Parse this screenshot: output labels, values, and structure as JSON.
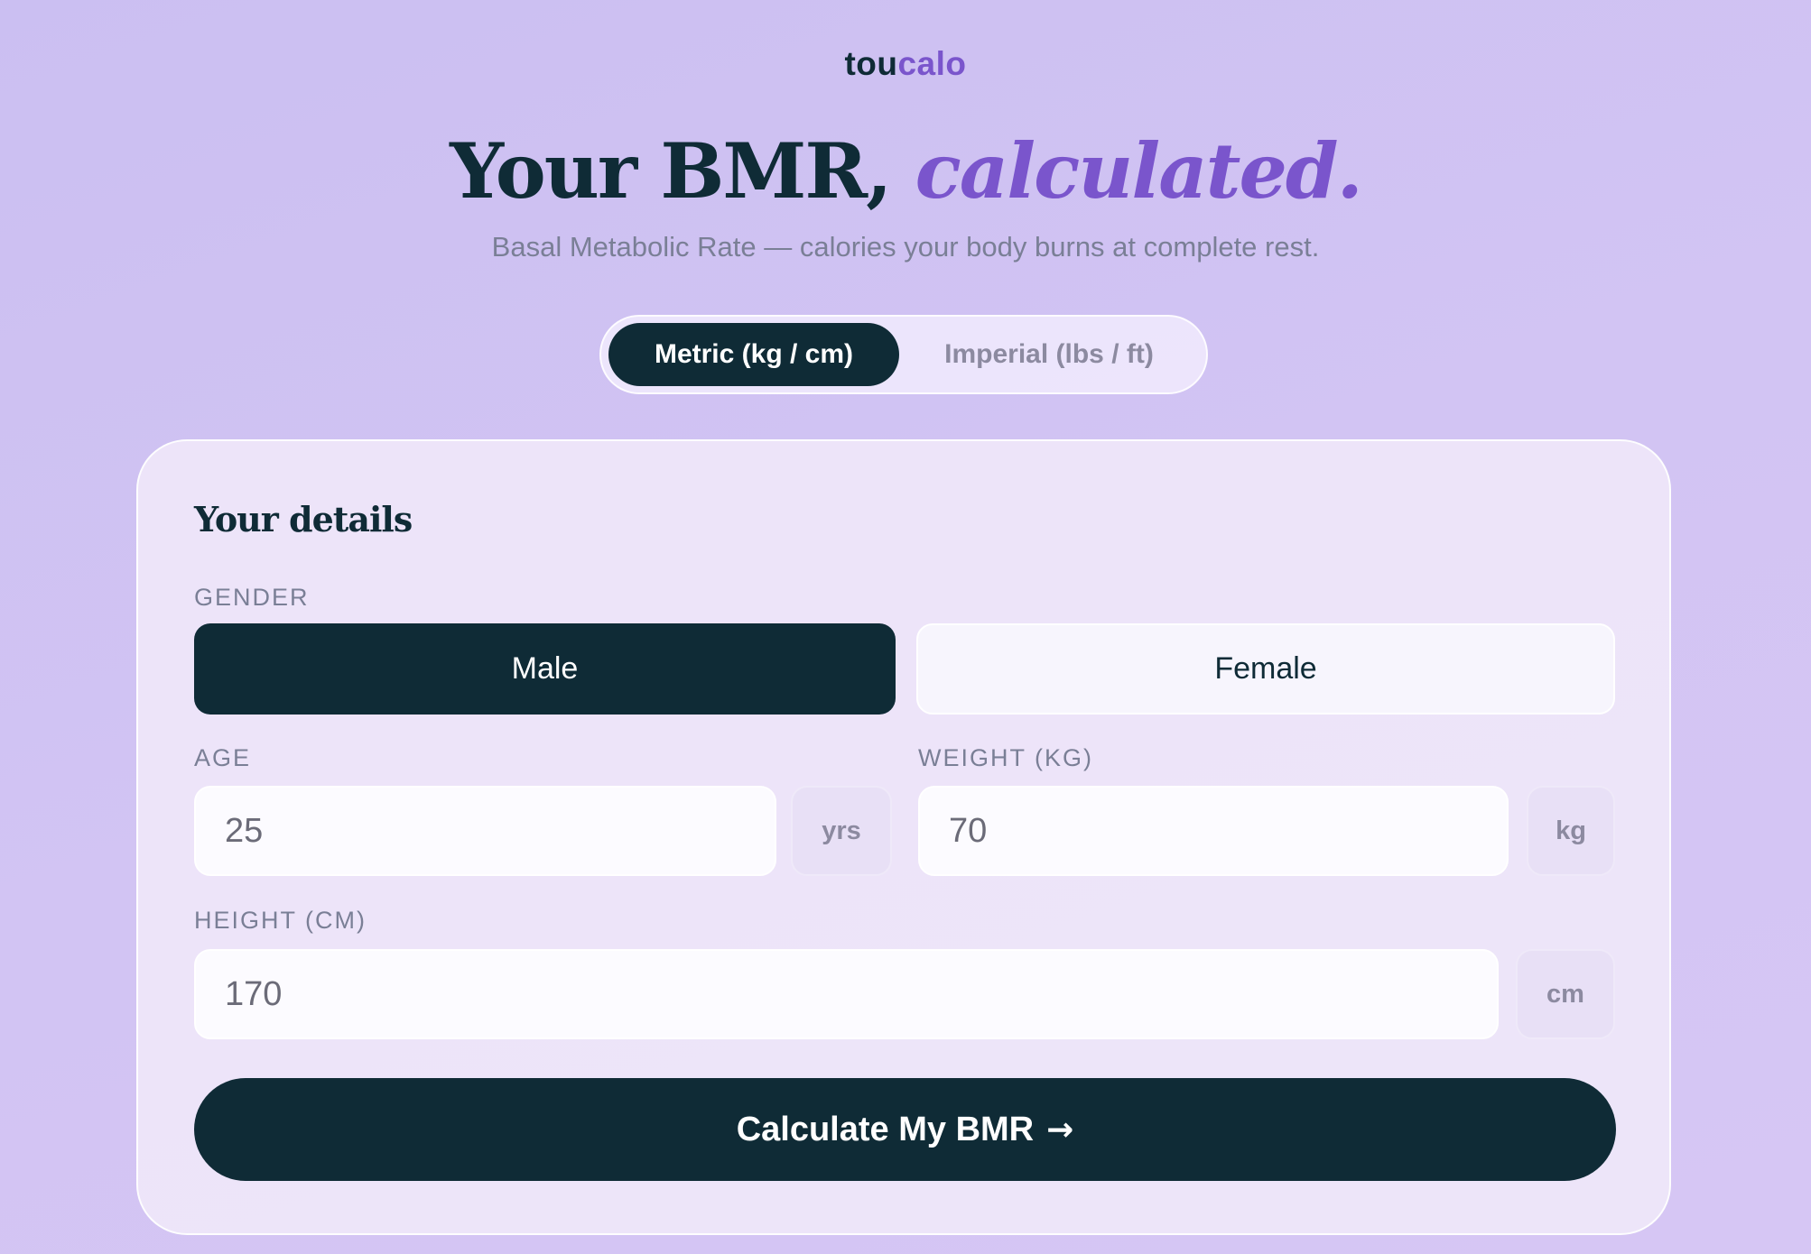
{
  "brand": {
    "part1": "tou",
    "part2": "calo"
  },
  "hero": {
    "title_main": "Your BMR,",
    "title_accent": "calculated.",
    "subtitle": "Basal Metabolic Rate — calories your body burns at complete rest."
  },
  "unit_toggle": {
    "metric_label": "Metric (kg / cm)",
    "imperial_label": "Imperial (lbs / ft)",
    "selected": "metric"
  },
  "form": {
    "title": "Your details",
    "gender": {
      "label": "GENDER",
      "male": "Male",
      "female": "Female",
      "selected": "male"
    },
    "age": {
      "label": "AGE",
      "value": "25",
      "unit": "yrs"
    },
    "weight": {
      "label": "WEIGHT (KG)",
      "value": "70",
      "unit": "kg"
    },
    "height": {
      "label": "HEIGHT (CM)",
      "value": "170",
      "unit": "cm"
    },
    "submit_label": "Calculate My BMR",
    "submit_icon": "→"
  },
  "colors": {
    "dark": "#0f2b36",
    "accent": "#7a55cc",
    "muted": "#7a7f96"
  }
}
